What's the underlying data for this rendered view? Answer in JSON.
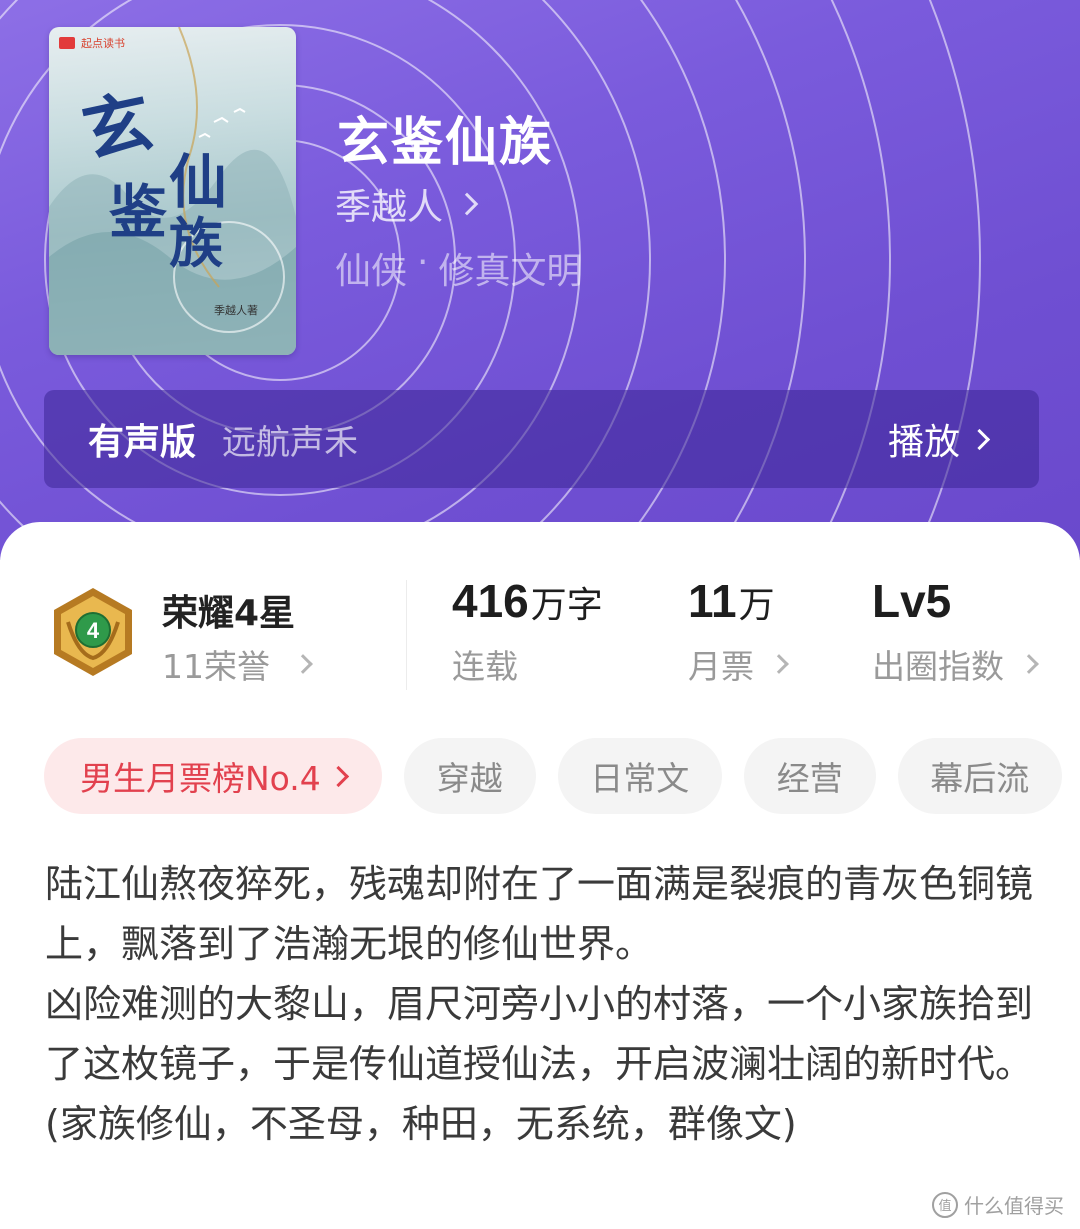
{
  "book": {
    "cover_publisher": "起点读书",
    "cover_title": "玄鉴仙族",
    "cover_author_mark": "季越人著",
    "title": "玄鉴仙族",
    "author": "季越人",
    "genre": "仙侠",
    "genre_sep": "·",
    "subgenre": "修真文明"
  },
  "audio": {
    "label": "有声版",
    "narrator": "远航声禾",
    "play_label": "播放"
  },
  "stats": {
    "honor_title": "荣耀4星",
    "honor_count": "11荣誉",
    "badge_level": "4",
    "words_value": "416",
    "words_unit": "万字",
    "words_label": "连载",
    "votes_value": "11",
    "votes_unit": "万",
    "votes_label": "月票",
    "level_value": "Lv5",
    "level_label": "出圈指数"
  },
  "tags": {
    "rank": "男生月票榜No.4",
    "items": [
      "穿越",
      "日常文",
      "经营",
      "幕后流"
    ]
  },
  "description": {
    "paragraph1": "陆江仙熬夜猝死，残魂却附在了一面满是裂痕的青灰色铜镜上，飘落到了浩瀚无垠的修仙世界。",
    "paragraph2": "凶险难测的大黎山，眉尺河旁小小的村落，一个小家族拾到了这枚镜子，于是传仙道授仙法，开启波澜壮阔的新时代。",
    "paragraph3": "(家族修仙，不圣母，种田，无系统，群像文)"
  },
  "watermark": "什么值得买",
  "colors": {
    "header_purple": "#7a5bdc",
    "rank_red": "#e2414e",
    "rank_bg": "#fde9ea",
    "badge_gold": "#d9a23a",
    "badge_green": "#2f9a4a"
  }
}
